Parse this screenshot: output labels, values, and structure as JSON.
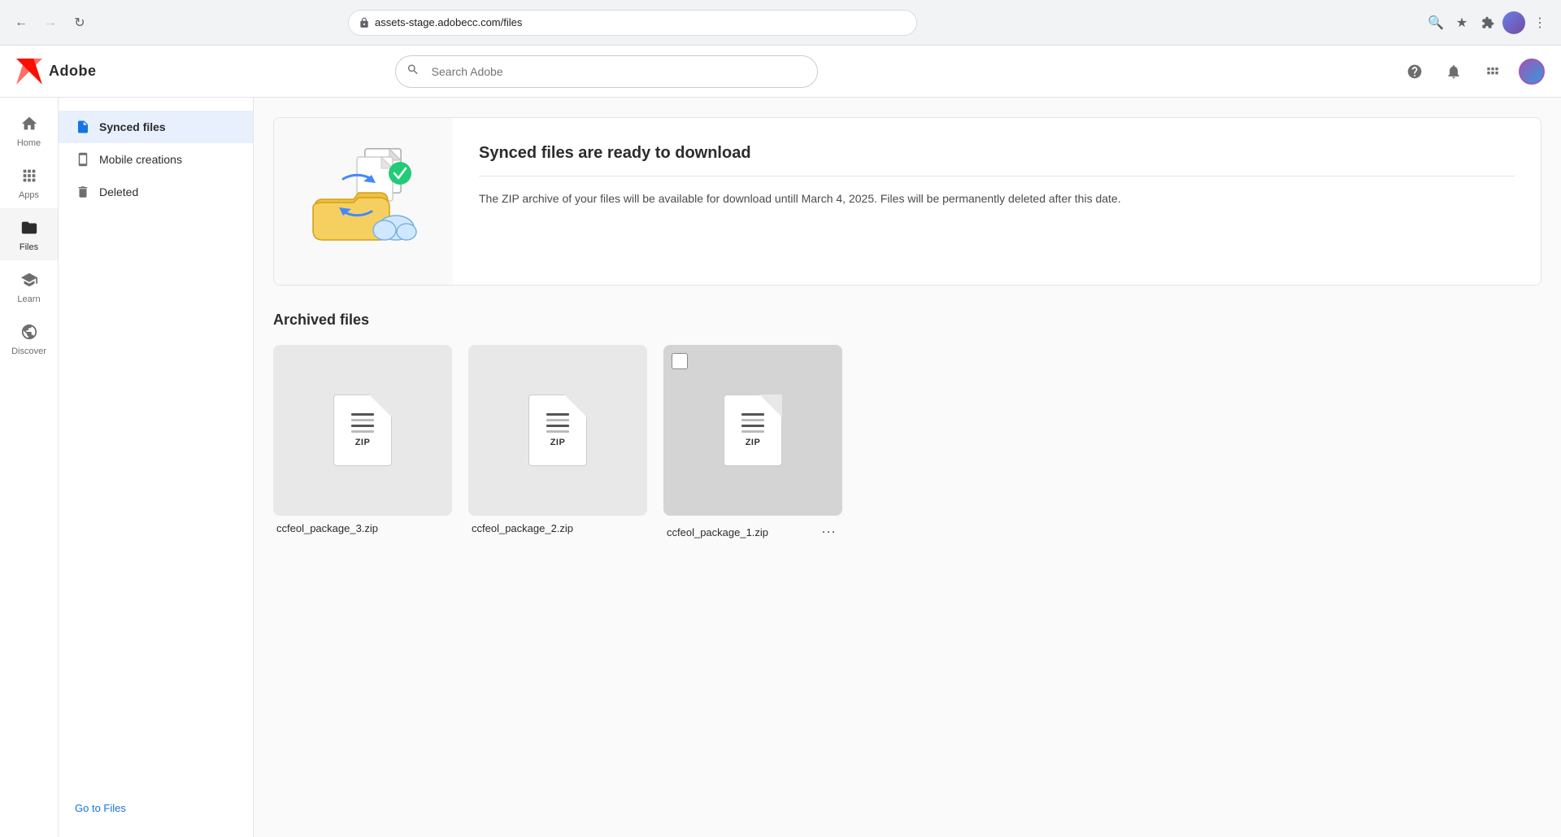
{
  "browser": {
    "url": "assets-stage.adobecc.com/files",
    "back_disabled": false,
    "forward_disabled": true
  },
  "header": {
    "logo_text": "Adobe",
    "search_placeholder": "Search Adobe"
  },
  "sidebar": {
    "items": [
      {
        "id": "home",
        "label": "Home",
        "icon": "home"
      },
      {
        "id": "apps",
        "label": "Apps",
        "icon": "apps"
      },
      {
        "id": "files",
        "label": "Files",
        "icon": "files",
        "active": true
      },
      {
        "id": "learn",
        "label": "Learn",
        "icon": "learn"
      },
      {
        "id": "discover",
        "label": "Discover",
        "icon": "discover"
      }
    ]
  },
  "secondary_sidebar": {
    "items": [
      {
        "id": "synced-files",
        "label": "Synced files",
        "icon": "file",
        "active": true
      },
      {
        "id": "mobile-creations",
        "label": "Mobile creations",
        "icon": "mobile"
      },
      {
        "id": "deleted",
        "label": "Deleted",
        "icon": "trash"
      }
    ],
    "goto_files_label": "Go to Files"
  },
  "banner": {
    "title": "Synced files are ready to download",
    "description": "The ZIP archive of your files will be available for download untill March 4, 2025. Files will be permanently deleted after this date."
  },
  "archived_files": {
    "section_title": "Archived files",
    "files": [
      {
        "id": "pkg3",
        "name": "ccfeol_package_3.zip",
        "label": "ZIP",
        "selected": false,
        "show_checkbox": false
      },
      {
        "id": "pkg2",
        "name": "ccfeol_package_2.zip",
        "label": "ZIP",
        "selected": false,
        "show_checkbox": false
      },
      {
        "id": "pkg1",
        "name": "ccfeol_package_1.zip",
        "label": "ZIP",
        "selected": true,
        "show_checkbox": true
      }
    ]
  }
}
